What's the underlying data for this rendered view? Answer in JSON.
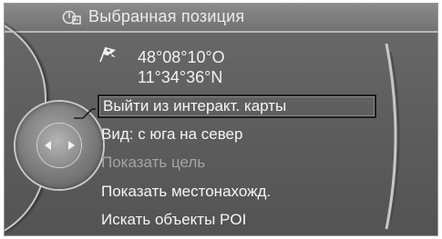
{
  "header": {
    "title": "Выбранная позиция",
    "icon": "map-pin-info-icon"
  },
  "location": {
    "icon": "flag-destination-icon",
    "latitude": "48°08°10°O",
    "longitude": "11°34°36°N"
  },
  "menu": {
    "items": [
      {
        "label": "Выйти из интеракт. карты",
        "selected": true,
        "enabled": true
      },
      {
        "label": "Вид: с юга на север",
        "selected": false,
        "enabled": true
      },
      {
        "label": "Показать цель",
        "selected": false,
        "enabled": false
      },
      {
        "label": "Показать местонахожд.",
        "selected": false,
        "enabled": true
      },
      {
        "label": "Искать объекты POI",
        "selected": false,
        "enabled": true
      }
    ]
  },
  "controller": {
    "left_icon": "arrow-left-icon",
    "right_icon": "arrow-right-icon"
  },
  "colors": {
    "background": "#5f5f5f",
    "text": "#f5f5f5",
    "disabled_text": "#a4a4a4",
    "selection_border": "#1c1c1c"
  }
}
